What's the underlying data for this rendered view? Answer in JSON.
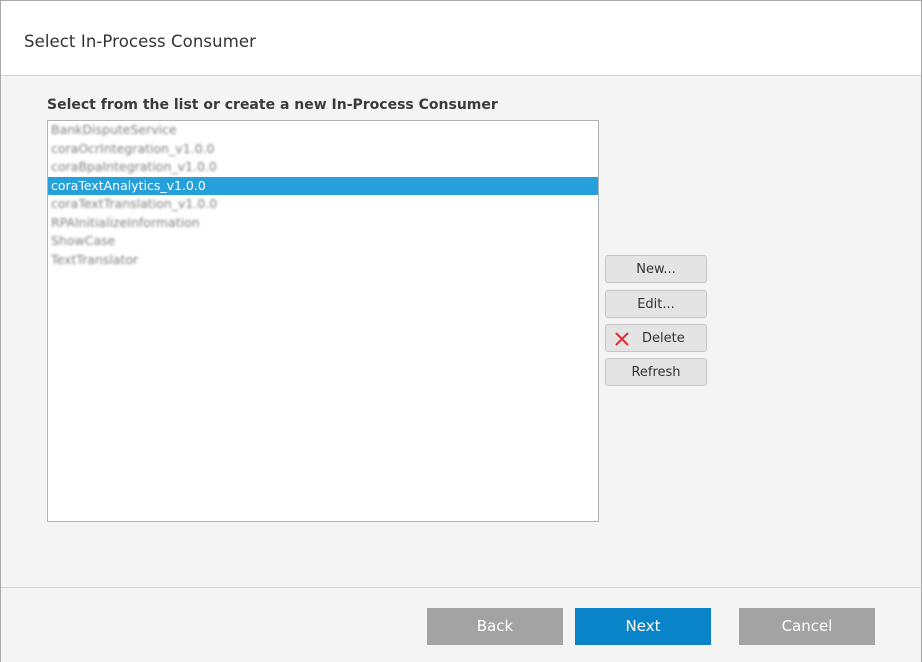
{
  "header": {
    "title": "Select In-Process Consumer"
  },
  "list": {
    "heading": "Select from the list or create a new In-Process Consumer",
    "items": [
      {
        "label": "BankDisputeService",
        "blurred": true,
        "selected": false
      },
      {
        "label": "coraOcrIntegration_v1.0.0",
        "blurred": true,
        "selected": false
      },
      {
        "label": "coraBpaIntegration_v1.0.0",
        "blurred": true,
        "selected": false
      },
      {
        "label": "coraTextAnalytics_v1.0.0",
        "blurred": false,
        "selected": true
      },
      {
        "label": "coraTextTranslation_v1.0.0",
        "blurred": true,
        "selected": false
      },
      {
        "label": "RPAInitializeInformation",
        "blurred": true,
        "selected": false
      },
      {
        "label": "ShowCase",
        "blurred": true,
        "selected": false
      },
      {
        "label": "TextTranslator",
        "blurred": true,
        "selected": false
      }
    ]
  },
  "actions": {
    "new_label": "New...",
    "edit_label": "Edit...",
    "delete_label": "Delete",
    "refresh_label": "Refresh",
    "delete_icon": "close-x-icon",
    "delete_icon_color": "#e0303a"
  },
  "footer": {
    "back_label": "Back",
    "next_label": "Next",
    "cancel_label": "Cancel"
  },
  "colors": {
    "selection": "#25a0da",
    "primary_button": "#0a84c8",
    "secondary_button": "#a3a3a3"
  }
}
